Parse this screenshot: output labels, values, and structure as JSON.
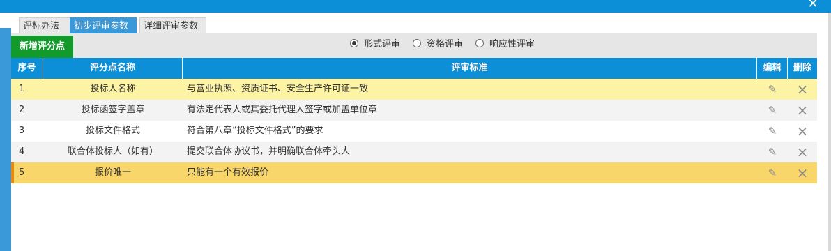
{
  "window": {
    "close_glyph": "✕"
  },
  "tabs": [
    {
      "label": "评标办法",
      "active": false
    },
    {
      "label": "初步评审参数",
      "active": true
    },
    {
      "label": "详细评审参数",
      "active": false
    }
  ],
  "toolbar": {
    "add_button_label": "新增评分点",
    "review_types": [
      {
        "label": "形式评审",
        "checked": true
      },
      {
        "label": "资格评审",
        "checked": false
      },
      {
        "label": "响应性评审",
        "checked": false
      }
    ]
  },
  "table": {
    "headers": [
      "序号",
      "评分点名称",
      "评审标准",
      "编辑",
      "删除"
    ],
    "rows": [
      {
        "no": "1",
        "name": "投标人名称",
        "standard": "与营业执照、资质证书、安全生产许可证一致"
      },
      {
        "no": "2",
        "name": "投标函签字盖章",
        "standard": "有法定代表人或其委托代理人签字或加盖单位章"
      },
      {
        "no": "3",
        "name": "投标文件格式",
        "standard": "符合第八章“投标文件格式”的要求"
      },
      {
        "no": "4",
        "name": "联合体投标人（如有）",
        "standard": "提交联合体协议书，并明确联合体牵头人"
      },
      {
        "no": "5",
        "name": "报价唯一",
        "standard": "只能有一个有效报价"
      }
    ],
    "edit_icon": "pencil-icon",
    "delete_icon": "close-icon"
  },
  "colors": {
    "header_blue": "#0c8fd6",
    "add_button_green": "#129a2a",
    "row_highlight_yellow": "#fcf3a4",
    "row_selected": "#f8d66a"
  }
}
